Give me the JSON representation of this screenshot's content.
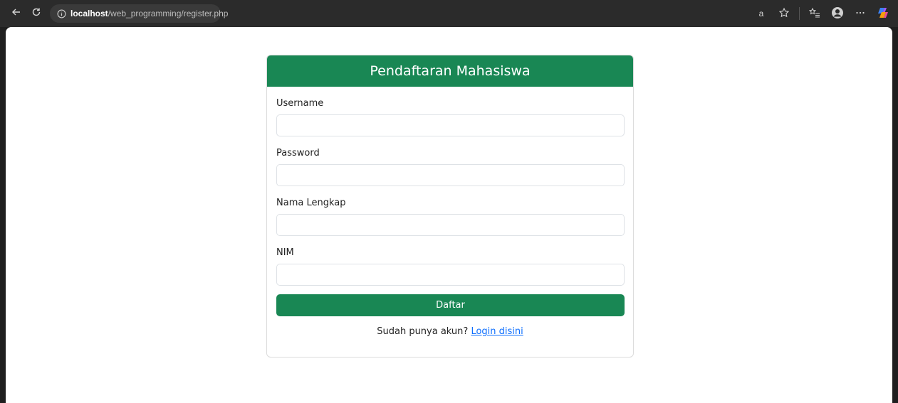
{
  "browser": {
    "url_host": "localhost",
    "url_path": "/web_programming/register.php",
    "read_aloud_label": "a",
    "icons": [
      "back-icon",
      "reload-icon",
      "info-icon",
      "read-aloud-icon",
      "favorite-star-icon",
      "favorites-list-icon",
      "profile-icon",
      "more-icon",
      "copilot-icon"
    ]
  },
  "form": {
    "title": "Pendaftaran Mahasiswa",
    "fields": [
      {
        "label": "Username",
        "value": "",
        "placeholder": ""
      },
      {
        "label": "Password",
        "value": "",
        "placeholder": ""
      },
      {
        "label": "Nama Lengkap",
        "value": "",
        "placeholder": ""
      },
      {
        "label": "NIM",
        "value": "",
        "placeholder": ""
      }
    ],
    "submit_label": "Daftar",
    "footer_prompt": "Sudah punya akun?",
    "footer_link": "Login disini"
  },
  "colors": {
    "primary_green": "#198754",
    "link_blue": "#0d6efd",
    "toolbar_bg": "#2b2b2b"
  }
}
